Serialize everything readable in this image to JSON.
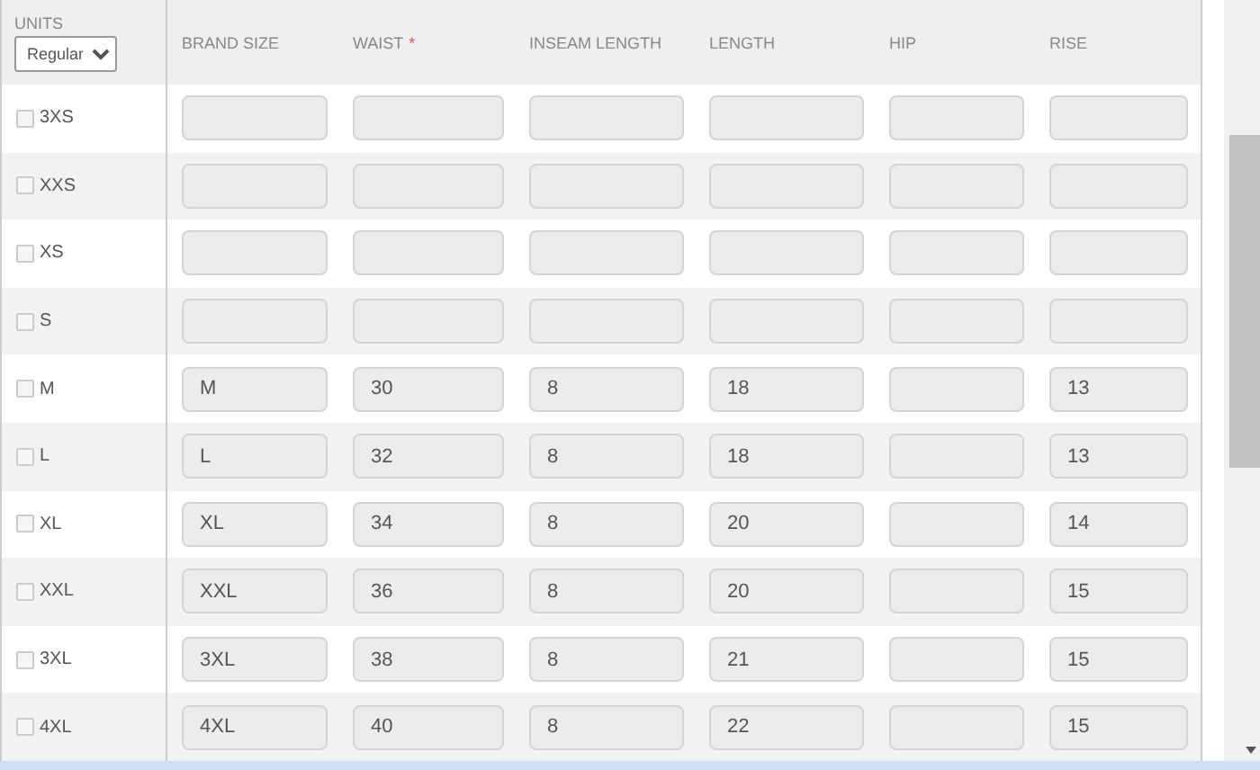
{
  "units": {
    "label": "UNITS",
    "value": "Regular"
  },
  "columns": [
    {
      "label": "BRAND SIZE"
    },
    {
      "label": "WAIST",
      "required_mark": "*"
    },
    {
      "label": "INSEAM LENGTH"
    },
    {
      "label": "LENGTH"
    },
    {
      "label": "HIP"
    },
    {
      "label": "RISE"
    }
  ],
  "rows": [
    {
      "size": "3XS",
      "checked": false,
      "cells": {}
    },
    {
      "size": "XXS",
      "checked": false,
      "cells": {}
    },
    {
      "size": "XS",
      "checked": false,
      "cells": {}
    },
    {
      "size": "S",
      "checked": false,
      "cells": {}
    },
    {
      "size": "M",
      "checked": false,
      "cells": {
        "brand_size": "M",
        "waist": "30",
        "inseam_length": "8",
        "length": "18",
        "rise": "13"
      }
    },
    {
      "size": "L",
      "checked": false,
      "cells": {
        "brand_size": "L",
        "waist": "32",
        "inseam_length": "8",
        "length": "18",
        "rise": "13"
      }
    },
    {
      "size": "XL",
      "checked": false,
      "cells": {
        "brand_size": "XL",
        "waist": "34",
        "inseam_length": "8",
        "length": "20",
        "rise": "14"
      }
    },
    {
      "size": "XXL",
      "checked": false,
      "cells": {
        "brand_size": "XXL",
        "waist": "36",
        "inseam_length": "8",
        "length": "20",
        "rise": "15"
      }
    },
    {
      "size": "3XL",
      "checked": false,
      "cells": {
        "brand_size": "3XL",
        "waist": "38",
        "inseam_length": "8",
        "length": "21",
        "rise": "15"
      }
    },
    {
      "size": "4XL",
      "checked": false,
      "cells": {
        "brand_size": "4XL",
        "waist": "40",
        "inseam_length": "8",
        "length": "22",
        "rise": "15"
      }
    }
  ]
}
